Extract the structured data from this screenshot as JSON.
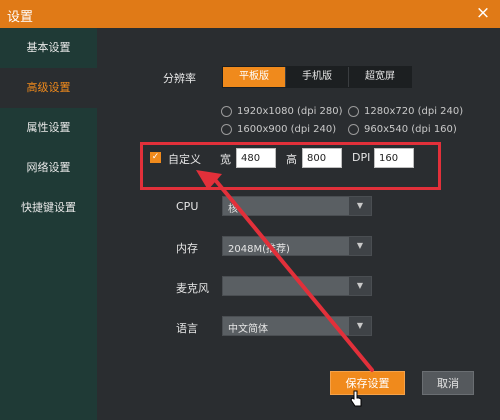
{
  "window": {
    "title": "设置",
    "close_glyph": "×"
  },
  "sidebar": {
    "items": [
      {
        "label": "基本设置"
      },
      {
        "label": "高级设置"
      },
      {
        "label": "属性设置"
      },
      {
        "label": "网络设置"
      },
      {
        "label": "快捷键设置"
      }
    ],
    "active_index": 1
  },
  "resolution": {
    "label": "分辨率",
    "tabs": [
      "平板版",
      "手机版",
      "超宽屏"
    ],
    "active_tab": "平板版",
    "options": [
      "1920x1080 (dpi 280)",
      "1280x720 (dpi 240)",
      "1600x900 (dpi 240)",
      "960x540 (dpi 160)"
    ]
  },
  "custom": {
    "checked": true,
    "check_glyph": "✓",
    "label": "自定义",
    "width_label": "宽",
    "width_value": "480",
    "height_label": "高",
    "height_value": "800",
    "dpi_label": "DPI",
    "dpi_value": "160"
  },
  "fields": {
    "cpu": {
      "label": "CPU",
      "value": "核"
    },
    "memory": {
      "label": "内存",
      "value": "2048M(推荐)"
    },
    "microphone": {
      "label": "麦克风",
      "value": ""
    },
    "language": {
      "label": "语言",
      "value": "中文简体"
    }
  },
  "dropdown_glyph": "▼",
  "buttons": {
    "save": "保存设置",
    "cancel": "取消"
  },
  "colors": {
    "accent": "#f08a1c",
    "highlight_red": "#e2303a",
    "sidebar_bg": "#1f3a36",
    "panel_bg": "#2a2d30"
  }
}
